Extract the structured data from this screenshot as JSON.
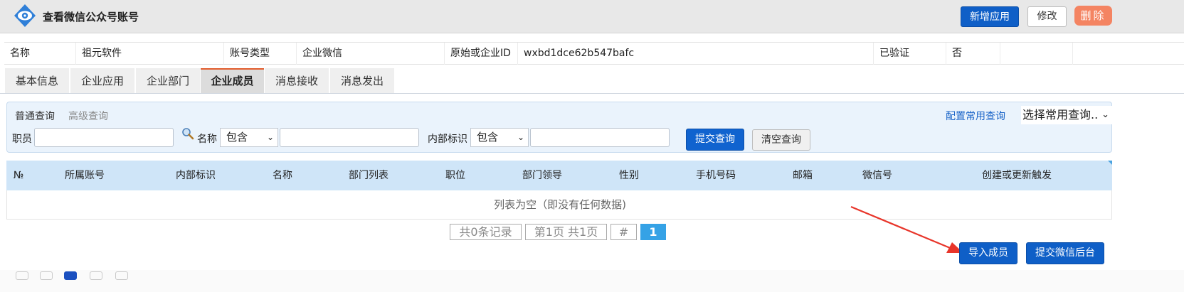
{
  "header": {
    "title": "查看微信公众号账号",
    "buttons": {
      "new": "新增应用",
      "edit": "修改",
      "delete": "删除"
    }
  },
  "info": {
    "name_label": "名称",
    "name_value": "祖元软件",
    "type_label": "账号类型",
    "type_value": "企业微信",
    "id_label": "原始或企业ID",
    "id_value": "wxbd1dce62b547bafc",
    "verified_label": "已验证",
    "verified_value": "否"
  },
  "tabs": [
    "基本信息",
    "企业应用",
    "企业部门",
    "企业成员",
    "消息接收",
    "消息发出"
  ],
  "active_tab": "企业成员",
  "query": {
    "mode_normal": "普通查询",
    "mode_advanced": "高级查询",
    "config_link": "配置常用查询",
    "common_select": "选择常用查询..",
    "employee_label": "职员",
    "employee_value": "",
    "name_label": "名称",
    "name_op": "包含",
    "name_value": "",
    "internal_label": "内部标识",
    "internal_op": "包含",
    "internal_value": "",
    "submit": "提交查询",
    "clear": "清空查询"
  },
  "table": {
    "columns": [
      "№",
      "所属账号",
      "内部标识",
      "名称",
      "部门列表",
      "职位",
      "部门领导",
      "性别",
      "手机号码",
      "邮箱",
      "微信号",
      "创建或更新触发"
    ],
    "empty_text": "列表为空（即没有任何数据)"
  },
  "pager": {
    "total": "共0条记录",
    "pages": "第1页 共1页",
    "jump": "#",
    "current": "1"
  },
  "actions": {
    "import": "导入成员",
    "push": "提交微信后台"
  },
  "colors": {
    "primary": "#0f5fc7",
    "danger": "#f48462",
    "tab_accent": "#e25b2b",
    "header_bg": "#e8e8e8",
    "table_head": "#cfe5f8",
    "annotation_arrow": "#e8352a"
  }
}
